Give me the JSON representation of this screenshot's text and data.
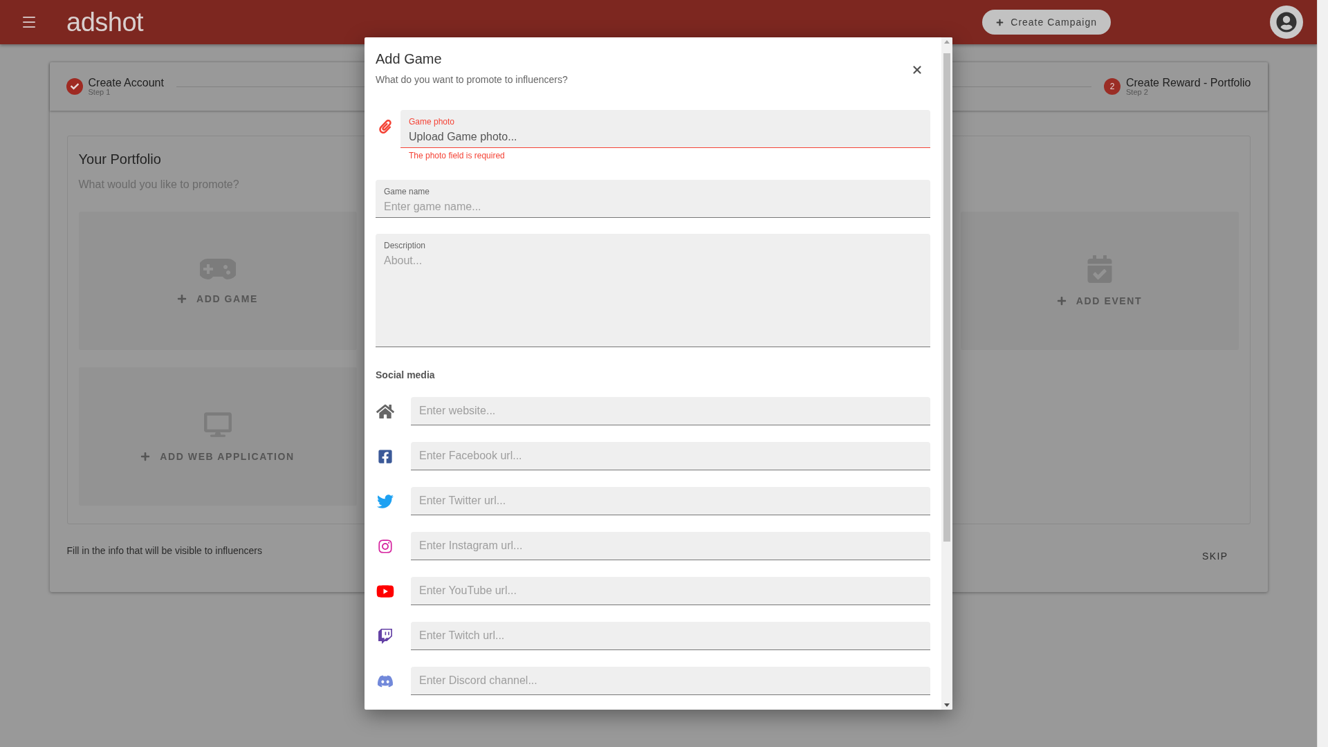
{
  "header": {
    "logo": "adshot",
    "action_button": "Create Campaign"
  },
  "stepper": {
    "steps": [
      {
        "title": "Create Account",
        "caption": "Step 1",
        "completed": true
      },
      {
        "number": "2",
        "title": "Create Reward - Portfolio",
        "caption": "Step 2",
        "completed": false
      }
    ]
  },
  "portfolio": {
    "title": "Your Portfolio",
    "subtitle": "What would you like to promote?",
    "tiles": [
      {
        "kind": "game",
        "label": "ADD GAME"
      },
      {
        "kind": "event",
        "label": "ADD EVENT"
      },
      {
        "kind": "web",
        "label": "ADD WEB APPLICATION"
      }
    ]
  },
  "footer": {
    "note": "Fill in the info that will be visible to influencers",
    "skip_button": "SKIP"
  },
  "dialog": {
    "title": "Add Game",
    "subtitle": "What do you want to promote to influencers?",
    "photo_field": {
      "label": "Game photo",
      "placeholder": "Upload Game photo...",
      "error": "The photo field is required",
      "invalid": true
    },
    "name_field": {
      "label": "Game name",
      "placeholder": "Enter game name..."
    },
    "description_field": {
      "label": "Description",
      "placeholder": "About..."
    },
    "social_heading": "Social media",
    "social_links": [
      {
        "kind": "website",
        "placeholder": "Enter website..."
      },
      {
        "kind": "facebook",
        "placeholder": "Enter Facebook url..."
      },
      {
        "kind": "twitter",
        "placeholder": "Enter Twitter url..."
      },
      {
        "kind": "instagram",
        "placeholder": "Enter Instagram url..."
      },
      {
        "kind": "youtube",
        "placeholder": "Enter YouTube url..."
      },
      {
        "kind": "twitch",
        "placeholder": "Enter Twitch url..."
      },
      {
        "kind": "discord",
        "placeholder": "Enter Discord channel..."
      }
    ]
  }
}
